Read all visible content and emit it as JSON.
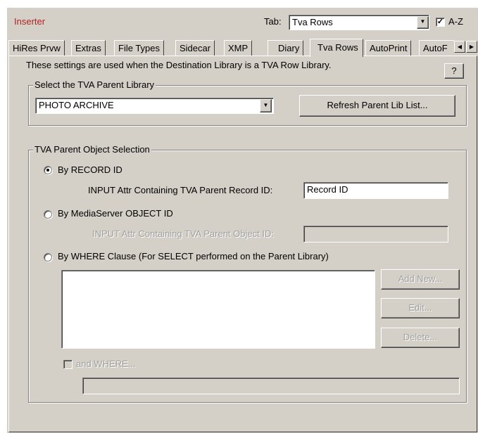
{
  "header": {
    "title": "Inserter",
    "tab_label": "Tab:",
    "tab_select_value": "Tva Rows",
    "az_checked": "✓",
    "az_label": "A-Z"
  },
  "tabs": [
    {
      "label": "HiRes Prvw"
    },
    {
      "label": "Extras"
    },
    {
      "label": "File Types"
    },
    {
      "label": "Sidecar"
    },
    {
      "label": "XMP"
    },
    {
      "label": "Diary"
    },
    {
      "label": "Tva Rows"
    },
    {
      "label": "AutoPrint"
    },
    {
      "label": "AutoF"
    }
  ],
  "icons": {
    "dropdown": "▼",
    "scroll_left": "◀",
    "scroll_right": "▶"
  },
  "panel": {
    "description": "These settings are used when the Destination Library is a TVA Row Library.",
    "help_label": "?",
    "parent_library_group": "Select the TVA Parent Library",
    "parent_library_value": "PHOTO ARCHIVE",
    "refresh_button": "Refresh Parent Lib List...",
    "selection_group": "TVA Parent Object Selection",
    "by_record_id": "By RECORD ID",
    "record_id_attr_label": "INPUT Attr Containing TVA Parent Record ID:",
    "record_id_attr_value": "Record ID",
    "by_object_id": "By MediaServer OBJECT ID",
    "object_id_attr_label": "INPUT Attr Containing TVA Parent Object ID:",
    "object_id_attr_value": "",
    "by_where": "By WHERE Clause  (For SELECT performed on the Parent Library)",
    "where_text": "",
    "add_new_button": "Add New...",
    "edit_button": "Edit...",
    "delete_button": "Delete...",
    "and_where_label": "and WHERE...",
    "and_where_value": ""
  }
}
